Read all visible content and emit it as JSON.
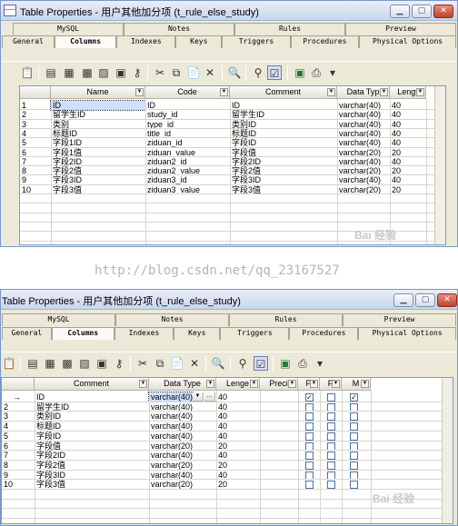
{
  "screens": {
    "top": {
      "title": "Table Properties - 用户其他加分项 (t_rule_else_study)",
      "tabs_upper": [
        "MySQL",
        "Notes",
        "Rules",
        "Preview"
      ],
      "tabs_lower": [
        "General",
        "Columns",
        "Indexes",
        "Keys",
        "Triggers",
        "Procedures",
        "Physical Options"
      ],
      "active_tab": "Columns",
      "headers": [
        "Name",
        "Code",
        "Comment",
        "Data Typ",
        "Lengt"
      ],
      "rows": [
        {
          "num": "1",
          "name": "ID",
          "code": "ID",
          "comment": "ID",
          "type": "varchar(40)",
          "len": "40"
        },
        {
          "num": "2",
          "name": "留学生ID",
          "code": "study_id",
          "comment": "留学生ID",
          "type": "varchar(40)",
          "len": "40"
        },
        {
          "num": "3",
          "name": "类别",
          "code": "type_id",
          "comment": "类别ID",
          "type": "varchar(40)",
          "len": "40"
        },
        {
          "num": "4",
          "name": "标题ID",
          "code": "title_id",
          "comment": "标题ID",
          "type": "varchar(40)",
          "len": "40"
        },
        {
          "num": "5",
          "name": "字段1ID",
          "code": "ziduan_id",
          "comment": "字段ID",
          "type": "varchar(40)",
          "len": "40"
        },
        {
          "num": "6",
          "name": "字段1值",
          "code": "ziduan_value",
          "comment": "字段值",
          "type": "varchar(20)",
          "len": "20"
        },
        {
          "num": "7",
          "name": "字段2ID",
          "code": "ziduan2_id",
          "comment": "字段2ID",
          "type": "varchar(40)",
          "len": "40"
        },
        {
          "num": "8",
          "name": "字段2值",
          "code": "ziduan2_value",
          "comment": "字段2值",
          "type": "varchar(20)",
          "len": "20"
        },
        {
          "num": "9",
          "name": "字段3ID",
          "code": "ziduan3_id",
          "comment": "字段3ID",
          "type": "varchar(40)",
          "len": "40"
        },
        {
          "num": "10",
          "name": "字段3值",
          "code": "ziduan3_value",
          "comment": "字段3值",
          "type": "varchar(20)",
          "len": "20"
        }
      ]
    },
    "bottom": {
      "title": "Table Properties - 用户其他加分项 (t_rule_else_study)",
      "tabs_upper": [
        "MySQL",
        "Notes",
        "Rules",
        "Preview"
      ],
      "tabs_lower": [
        "General",
        "Columns",
        "Indexes",
        "Keys",
        "Triggers",
        "Procedures",
        "Physical Options"
      ],
      "active_tab": "Columns",
      "headers": [
        "Comment",
        "Data Type",
        "Lenge",
        "Preci",
        "P",
        "F",
        "M"
      ],
      "rows": [
        {
          "num": "→",
          "comment": "ID",
          "type": "varchar(40)",
          "len": "40",
          "p": true,
          "f": false,
          "m": true
        },
        {
          "num": "2",
          "comment": "留学生ID",
          "type": "varchar(40)",
          "len": "40",
          "p": false,
          "f": false,
          "m": false
        },
        {
          "num": "3",
          "comment": "类别ID",
          "type": "varchar(40)",
          "len": "40",
          "p": false,
          "f": false,
          "m": false
        },
        {
          "num": "4",
          "comment": "标题ID",
          "type": "varchar(40)",
          "len": "40",
          "p": false,
          "f": false,
          "m": false
        },
        {
          "num": "5",
          "comment": "字段ID",
          "type": "varchar(40)",
          "len": "40",
          "p": false,
          "f": false,
          "m": false
        },
        {
          "num": "6",
          "comment": "字段值",
          "type": "varchar(20)",
          "len": "20",
          "p": false,
          "f": false,
          "m": false
        },
        {
          "num": "7",
          "comment": "字段2ID",
          "type": "varchar(40)",
          "len": "40",
          "p": false,
          "f": false,
          "m": false
        },
        {
          "num": "8",
          "comment": "字段2值",
          "type": "varchar(20)",
          "len": "20",
          "p": false,
          "f": false,
          "m": false
        },
        {
          "num": "9",
          "comment": "字段3ID",
          "type": "varchar(40)",
          "len": "40",
          "p": false,
          "f": false,
          "m": false
        },
        {
          "num": "10",
          "comment": "字段3值",
          "type": "varchar(20)",
          "len": "20",
          "p": false,
          "f": false,
          "m": false
        }
      ]
    }
  },
  "watermark": "http://blog.csdn.net/qq_23167527",
  "baidu_mark": "Bai 经验",
  "colors": {
    "title_gradient_top": "#e9eef8",
    "window_bg": "#ece9d8",
    "grid_border": "#7f9db9",
    "selected_cell": "#cfe0ff",
    "checkbox_border": "#4d6fa6"
  },
  "window_buttons": [
    "minimize",
    "maximize",
    "close"
  ],
  "toolbar_icons": [
    "properties-icon",
    "insert-row-icon",
    "add-row-icon",
    "add-columns-icon",
    "remove-columns-icon",
    "folder-icon",
    "key-icon",
    "cut-icon",
    "copy-icon",
    "paste-icon",
    "delete-icon",
    "find-icon",
    "filter-icon",
    "customize-columns-icon",
    "excel-icon",
    "print-icon",
    "more-icon"
  ]
}
